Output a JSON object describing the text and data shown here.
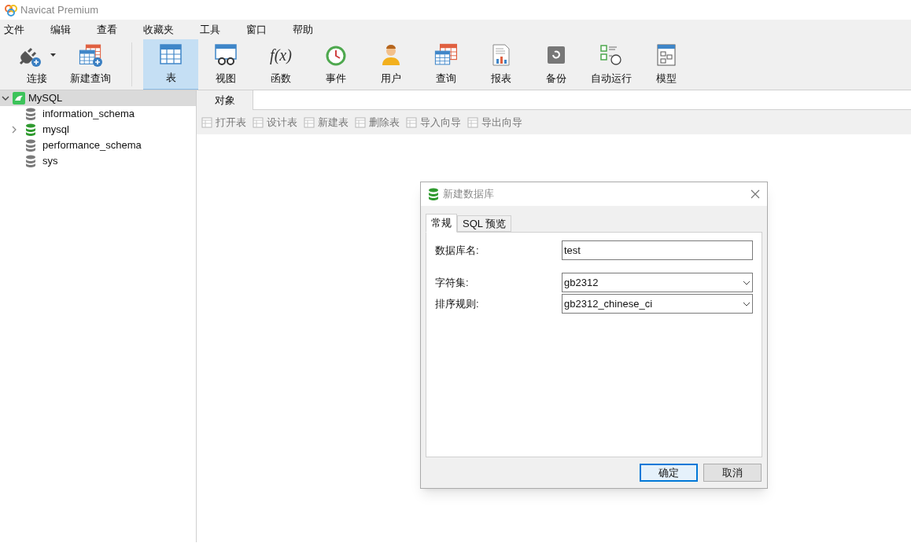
{
  "window": {
    "title": "Navicat Premium"
  },
  "menu": [
    "文件",
    "编辑",
    "查看",
    "收藏夹",
    "工具",
    "窗口",
    "帮助"
  ],
  "toolbar": {
    "left": [
      {
        "label": "连接",
        "dropdown": true
      },
      {
        "label": "新建查询",
        "dropdown": false
      }
    ],
    "objects": [
      {
        "label": "表",
        "selected": true
      },
      {
        "label": "视图",
        "selected": false
      },
      {
        "label": "函数",
        "selected": false,
        "icon_glyph": "f(x)"
      },
      {
        "label": "事件",
        "selected": false
      },
      {
        "label": "用户",
        "selected": false
      },
      {
        "label": "查询",
        "selected": false
      },
      {
        "label": "报表",
        "selected": false
      },
      {
        "label": "备份",
        "selected": false
      },
      {
        "label": "自动运行",
        "selected": false
      },
      {
        "label": "模型",
        "selected": false
      }
    ]
  },
  "sidebar": {
    "tree": [
      {
        "label": "MySQL",
        "expanded": true,
        "selected": true,
        "children": [
          {
            "label": "information_schema",
            "open": false,
            "expandable": false
          },
          {
            "label": "mysql",
            "open": true,
            "expandable": true
          },
          {
            "label": "performance_schema",
            "open": false,
            "expandable": false
          },
          {
            "label": "sys",
            "open": false,
            "expandable": false
          }
        ]
      }
    ]
  },
  "tabs": [
    {
      "label": "对象",
      "selected": true
    }
  ],
  "object_toolbar": [
    "打开表",
    "设计表",
    "新建表",
    "删除表",
    "导入向导",
    "导出向导"
  ],
  "dialog": {
    "title": "新建数据库",
    "tabs": [
      {
        "label": "常规",
        "selected": true
      },
      {
        "label": "SQL 预览",
        "selected": false
      }
    ],
    "fields": [
      {
        "kind": "text",
        "label": "数据库名:",
        "value": "test"
      },
      {
        "kind": "select",
        "label": "字符集:",
        "value": "gb2312"
      },
      {
        "kind": "select",
        "label": "排序规则:",
        "value": "gb2312_chinese_ci"
      }
    ],
    "buttons": [
      {
        "label": "确定",
        "default": true
      },
      {
        "label": "取消",
        "default": false
      }
    ]
  }
}
